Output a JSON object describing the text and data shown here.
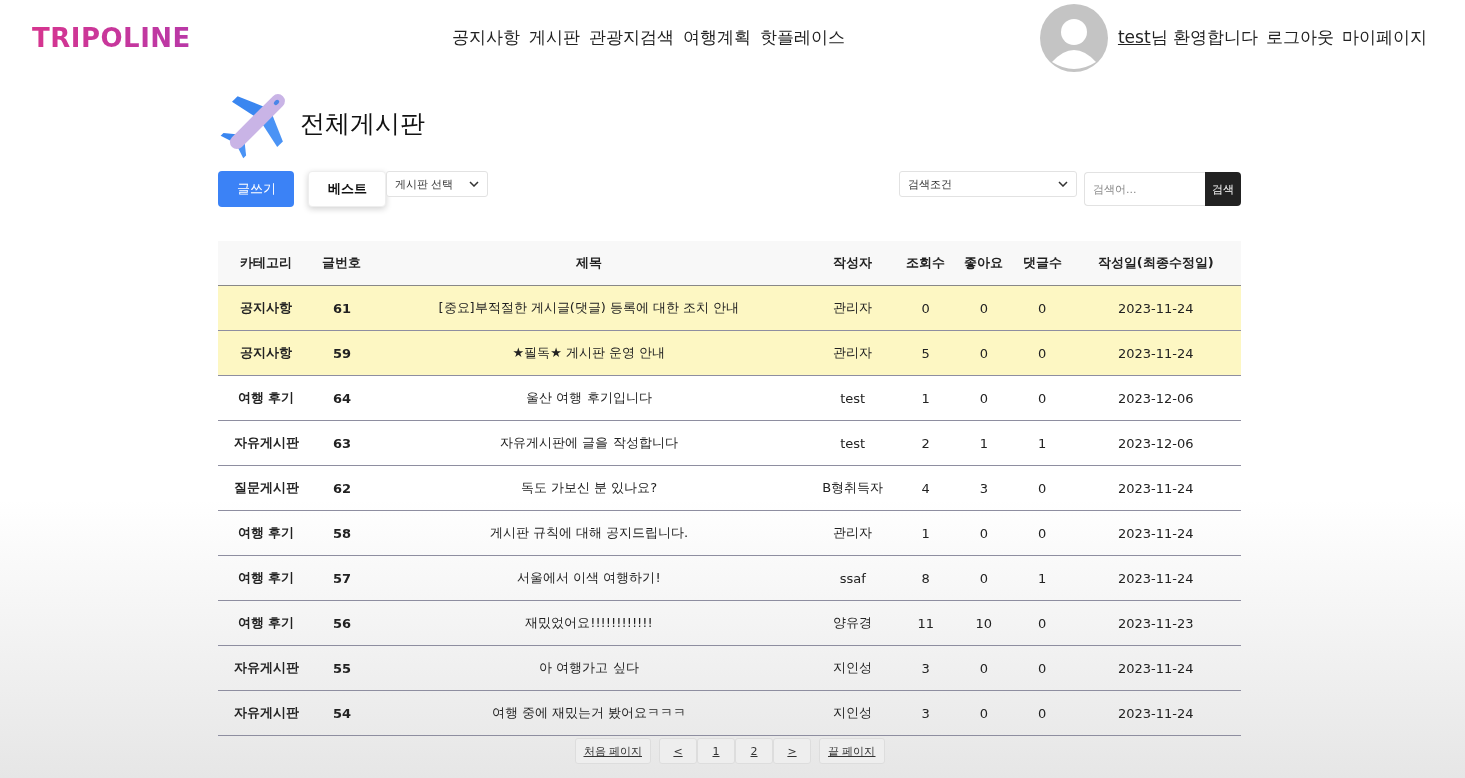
{
  "header": {
    "logo": "TRIPOLINE",
    "nav": [
      "공지사항",
      "게시판",
      "관광지검색",
      "여행계획",
      "핫플레이스"
    ],
    "user": {
      "name": "test",
      "greeting": "님 환영합니다"
    },
    "links": [
      "로그아웃",
      "마이페이지"
    ]
  },
  "page_title": "전체게시판",
  "toolbar": {
    "write_button": "글쓰기",
    "best_button": "베스트",
    "board_select": "게시판 선택",
    "condition_select": "검색조건",
    "search": {
      "placeholder": "검색어..."
    },
    "search_button": "검색"
  },
  "table": {
    "columns": [
      "카테고리",
      "글번호",
      "제목",
      "작성자",
      "조회수",
      "좋아요",
      "댓글수",
      "작성일(최종수정일)"
    ],
    "rows": [
      {
        "highlighted": true,
        "cells": [
          "공지사항",
          "61",
          "[중요]부적절한 게시글(댓글) 등록에 대한 조치 안내",
          "관리자",
          "0",
          "0",
          "0",
          "2023-11-24"
        ]
      },
      {
        "highlighted": true,
        "cells": [
          "공지사항",
          "59",
          "★필독★ 게시판 운영 안내",
          "관리자",
          "5",
          "0",
          "0",
          "2023-11-24"
        ]
      },
      {
        "highlighted": false,
        "cells": [
          "여행 후기",
          "64",
          "울산 여행 후기입니다",
          "test",
          "1",
          "0",
          "0",
          "2023-12-06"
        ]
      },
      {
        "highlighted": false,
        "cells": [
          "자유게시판",
          "63",
          "자유게시판에 글을 작성합니다",
          "test",
          "2",
          "1",
          "1",
          "2023-12-06"
        ]
      },
      {
        "highlighted": false,
        "cells": [
          "질문게시판",
          "62",
          "독도 가보신 분 있나요?",
          "B형취득자",
          "4",
          "3",
          "0",
          "2023-11-24"
        ]
      },
      {
        "highlighted": false,
        "cells": [
          "여행 후기",
          "58",
          "게시판 규칙에 대해 공지드립니다.",
          "관리자",
          "1",
          "0",
          "0",
          "2023-11-24"
        ]
      },
      {
        "highlighted": false,
        "cells": [
          "여행 후기",
          "57",
          "서울에서 이색 여행하기!",
          "ssaf",
          "8",
          "0",
          "1",
          "2023-11-24"
        ]
      },
      {
        "highlighted": false,
        "cells": [
          "여행 후기",
          "56",
          "재밌었어요!!!!!!!!!!!!",
          "양유경",
          "11",
          "10",
          "0",
          "2023-11-23"
        ]
      },
      {
        "highlighted": false,
        "cells": [
          "자유게시판",
          "55",
          "아 여행가고 싶다",
          "지인성",
          "3",
          "0",
          "0",
          "2023-11-24"
        ]
      },
      {
        "highlighted": false,
        "cells": [
          "자유게시판",
          "54",
          "여행 중에 재밌는거 봤어요ㅋㅋㅋ",
          "지인성",
          "3",
          "0",
          "0",
          "2023-11-24"
        ]
      }
    ]
  },
  "pagination": {
    "first": "처음 페이지",
    "prev": "<",
    "pages": [
      "1",
      "2"
    ],
    "next": ">",
    "last": "끝 페이지"
  }
}
